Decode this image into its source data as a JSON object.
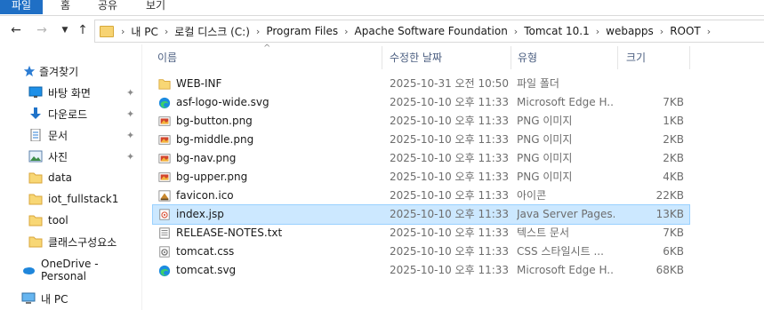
{
  "ribbon": {
    "tabs": [
      "파일",
      "홈",
      "공유",
      "보기"
    ]
  },
  "address": {
    "crumbs": [
      "내 PC",
      "로컬 디스크 (C:)",
      "Program Files",
      "Apache Software Foundation",
      "Tomcat 10.1",
      "webapps",
      "ROOT"
    ]
  },
  "columns": {
    "name": "이름",
    "date": "수정한 날짜",
    "type": "유형",
    "size": "크기"
  },
  "sidebar": {
    "quick_access": "즐겨찾기",
    "items": [
      {
        "label": "바탕 화면",
        "icon": "desktop-icon",
        "pinned": true
      },
      {
        "label": "다운로드",
        "icon": "download-icon",
        "pinned": true
      },
      {
        "label": "문서",
        "icon": "documents-icon",
        "pinned": true
      },
      {
        "label": "사진",
        "icon": "pictures-icon",
        "pinned": true
      },
      {
        "label": "data",
        "icon": "folder-icon",
        "pinned": false
      },
      {
        "label": "iot_fullstack1",
        "icon": "folder-icon",
        "pinned": false
      },
      {
        "label": "tool",
        "icon": "folder-icon",
        "pinned": false
      },
      {
        "label": "클래스구성요소",
        "icon": "folder-icon",
        "pinned": false
      }
    ],
    "onedrive": "OneDrive - Personal",
    "this_pc": "내 PC"
  },
  "files": [
    {
      "name": "WEB-INF",
      "date": "2025-10-31 오전 10:50",
      "type": "파일 폴더",
      "size": "",
      "icon": "folder-icon"
    },
    {
      "name": "asf-logo-wide.svg",
      "date": "2025-10-10 오후 11:33",
      "type": "Microsoft Edge H...",
      "size": "7KB",
      "icon": "edge-icon"
    },
    {
      "name": "bg-button.png",
      "date": "2025-10-10 오후 11:33",
      "type": "PNG 이미지",
      "size": "1KB",
      "icon": "image-icon"
    },
    {
      "name": "bg-middle.png",
      "date": "2025-10-10 오후 11:33",
      "type": "PNG 이미지",
      "size": "2KB",
      "icon": "image-icon"
    },
    {
      "name": "bg-nav.png",
      "date": "2025-10-10 오후 11:33",
      "type": "PNG 이미지",
      "size": "2KB",
      "icon": "image-icon"
    },
    {
      "name": "bg-upper.png",
      "date": "2025-10-10 오후 11:33",
      "type": "PNG 이미지",
      "size": "4KB",
      "icon": "image-icon"
    },
    {
      "name": "favicon.ico",
      "date": "2025-10-10 오후 11:33",
      "type": "아이콘",
      "size": "22KB",
      "icon": "ico-icon"
    },
    {
      "name": "index.jsp",
      "date": "2025-10-10 오후 11:33",
      "type": "Java Server Pages...",
      "size": "13KB",
      "icon": "jsp-icon",
      "selected": true
    },
    {
      "name": "RELEASE-NOTES.txt",
      "date": "2025-10-10 오후 11:33",
      "type": "텍스트 문서",
      "size": "7KB",
      "icon": "text-icon"
    },
    {
      "name": "tomcat.css",
      "date": "2025-10-10 오후 11:33",
      "type": "CSS 스타일시트 ...",
      "size": "6KB",
      "icon": "css-icon"
    },
    {
      "name": "tomcat.svg",
      "date": "2025-10-10 오후 11:33",
      "type": "Microsoft Edge H...",
      "size": "68KB",
      "icon": "edge-icon"
    }
  ]
}
